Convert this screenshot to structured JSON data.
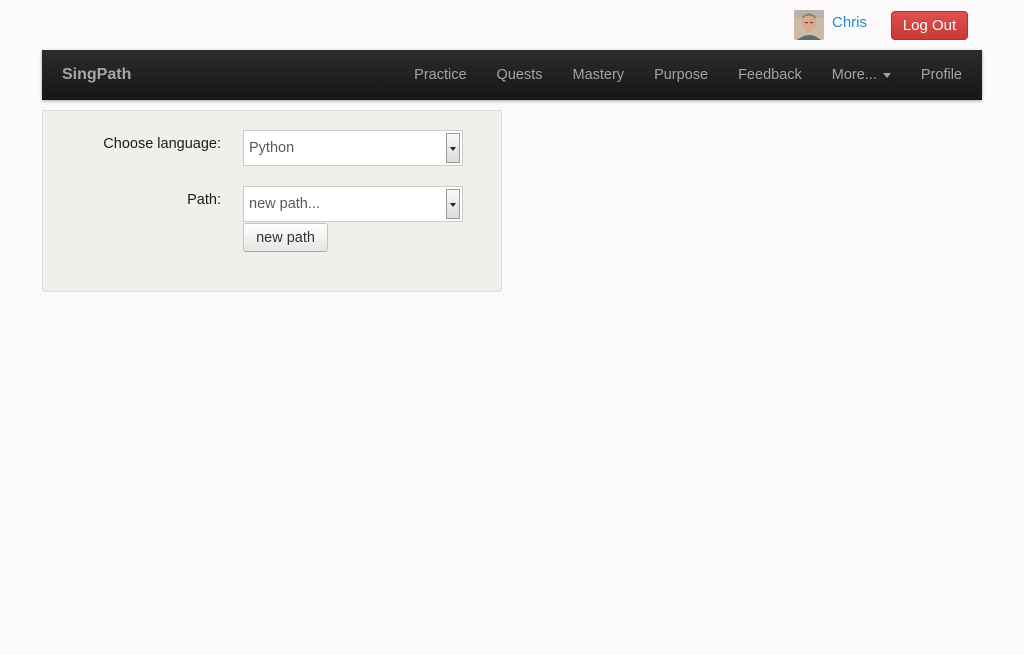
{
  "user": {
    "name": "Chris",
    "logout_label": "Log Out",
    "avatar_icon": "user-avatar-photo"
  },
  "navbar": {
    "brand": "SingPath",
    "items": [
      {
        "label": "Practice"
      },
      {
        "label": "Quests"
      },
      {
        "label": "Mastery"
      },
      {
        "label": "Purpose"
      },
      {
        "label": "Feedback"
      },
      {
        "label": "More...",
        "has_dropdown": true
      },
      {
        "label": "Profile"
      }
    ]
  },
  "form": {
    "language_label": "Choose language:",
    "language_value": "Python",
    "path_label": "Path:",
    "path_value": "new path...",
    "new_path_button": "new path"
  },
  "colors": {
    "accent_link": "#1d8fc6",
    "logout_red": "#d9534f",
    "navbar_dark": "#1b1b1b",
    "panel_bg": "#f0efea"
  }
}
